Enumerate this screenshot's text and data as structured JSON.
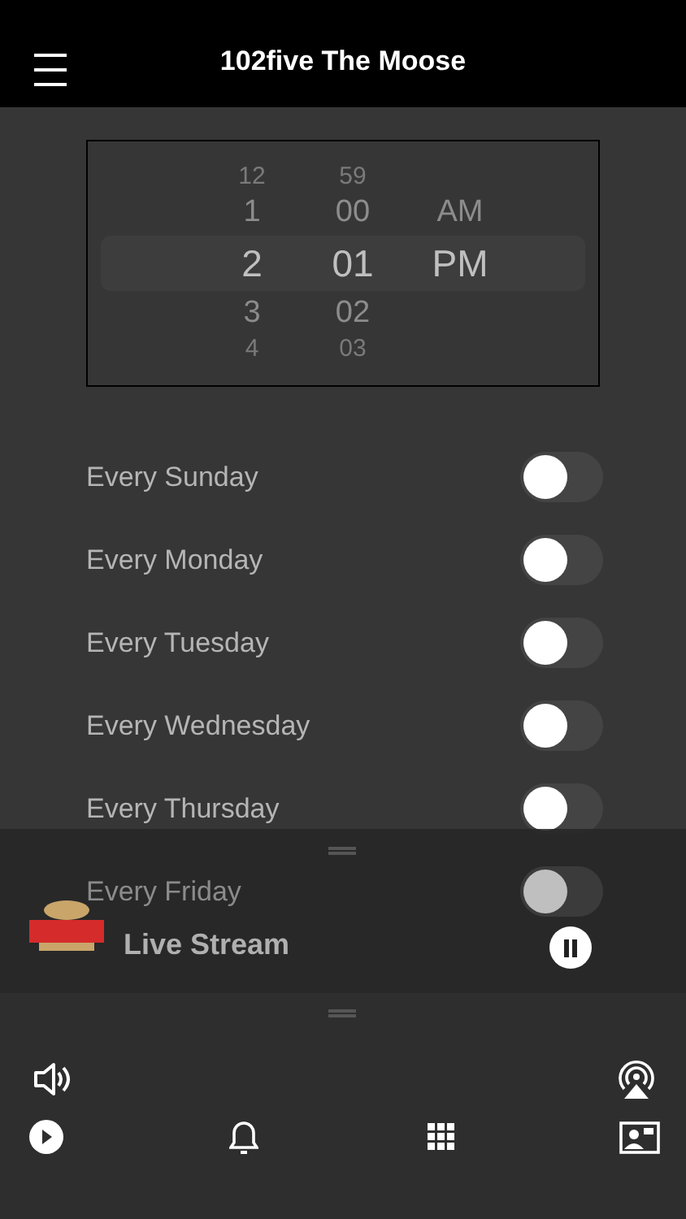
{
  "header": {
    "title": "102five The Moose"
  },
  "time_picker": {
    "columns": [
      {
        "items": [
          {
            "label": "12",
            "selected": false
          },
          {
            "label": "1",
            "selected": false
          },
          {
            "label": "2",
            "selected": true
          },
          {
            "label": "3",
            "selected": false
          },
          {
            "label": "4",
            "selected": false
          }
        ]
      },
      {
        "items": [
          {
            "label": "59",
            "selected": false
          },
          {
            "label": "00",
            "selected": false
          },
          {
            "label": "01",
            "selected": true
          },
          {
            "label": "02",
            "selected": false
          },
          {
            "label": "03",
            "selected": false
          }
        ]
      },
      {
        "items": [
          {
            "label": "AM",
            "selected": false
          },
          {
            "label": "PM",
            "selected": true
          }
        ]
      }
    ]
  },
  "repeat_days": [
    {
      "label": "Every Sunday",
      "on": false
    },
    {
      "label": "Every Monday",
      "on": false
    },
    {
      "label": "Every Tuesday",
      "on": false
    },
    {
      "label": "Every Wednesday",
      "on": false
    },
    {
      "label": "Every Thursday",
      "on": false
    },
    {
      "label": "Every Friday",
      "on": false
    }
  ],
  "mini_player": {
    "title": "Live Stream",
    "playing": true
  }
}
